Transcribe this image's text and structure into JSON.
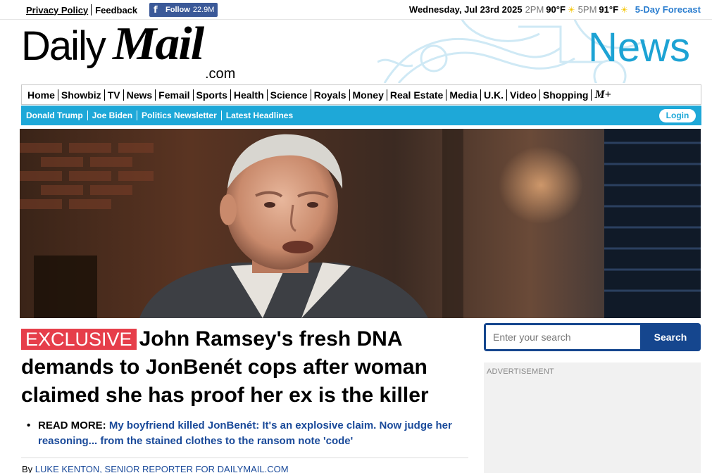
{
  "topbar": {
    "privacy": "Privacy Policy",
    "feedback": "Feedback",
    "follow_label": "Follow",
    "follow_count": "22.9M",
    "date": "Wednesday, Jul 23rd 2025",
    "weather": [
      {
        "time": "2PM",
        "temp": "90°F"
      },
      {
        "time": "5PM",
        "temp": "91°F"
      }
    ],
    "forecast": "5-Day Forecast"
  },
  "masthead": {
    "daily": "Daily",
    "mail": "Mail",
    "com": ".com",
    "channel": "News"
  },
  "nav": {
    "items": [
      "Home",
      "Showbiz",
      "TV",
      "News",
      "Femail",
      "Sports",
      "Health",
      "Science",
      "Royals",
      "Money",
      "Real Estate",
      "Media",
      "U.K.",
      "Video",
      "Shopping"
    ],
    "mplus": "M+"
  },
  "subnav": {
    "items": [
      "Donald Trump",
      "Joe Biden",
      "Politics Newsletter",
      "Latest Headlines"
    ],
    "login": "Login"
  },
  "article": {
    "badge": "EXCLUSIVE",
    "headline": "John Ramsey's fresh DNA demands to JonBenét cops after woman claimed she has proof her ex is the killer",
    "readmore_label": "READ MORE:",
    "readmore_link": "My boyfriend killed JonBenét: It's an explosive claim. Now judge her reasoning... from the stained clothes to the ransom note 'code'",
    "byline_prefix": "By",
    "byline_author": "LUKE KENTON, SENIOR REPORTER FOR DAILYMAIL.COM"
  },
  "search": {
    "placeholder": "Enter your search",
    "button": "Search"
  },
  "ad": {
    "label": "ADVERTISEMENT"
  },
  "colors": {
    "accent_blue": "#1ea8d8",
    "exclusive_red": "#e63e4a",
    "search_navy": "#15468e",
    "link_blue": "#1a4a9a"
  }
}
